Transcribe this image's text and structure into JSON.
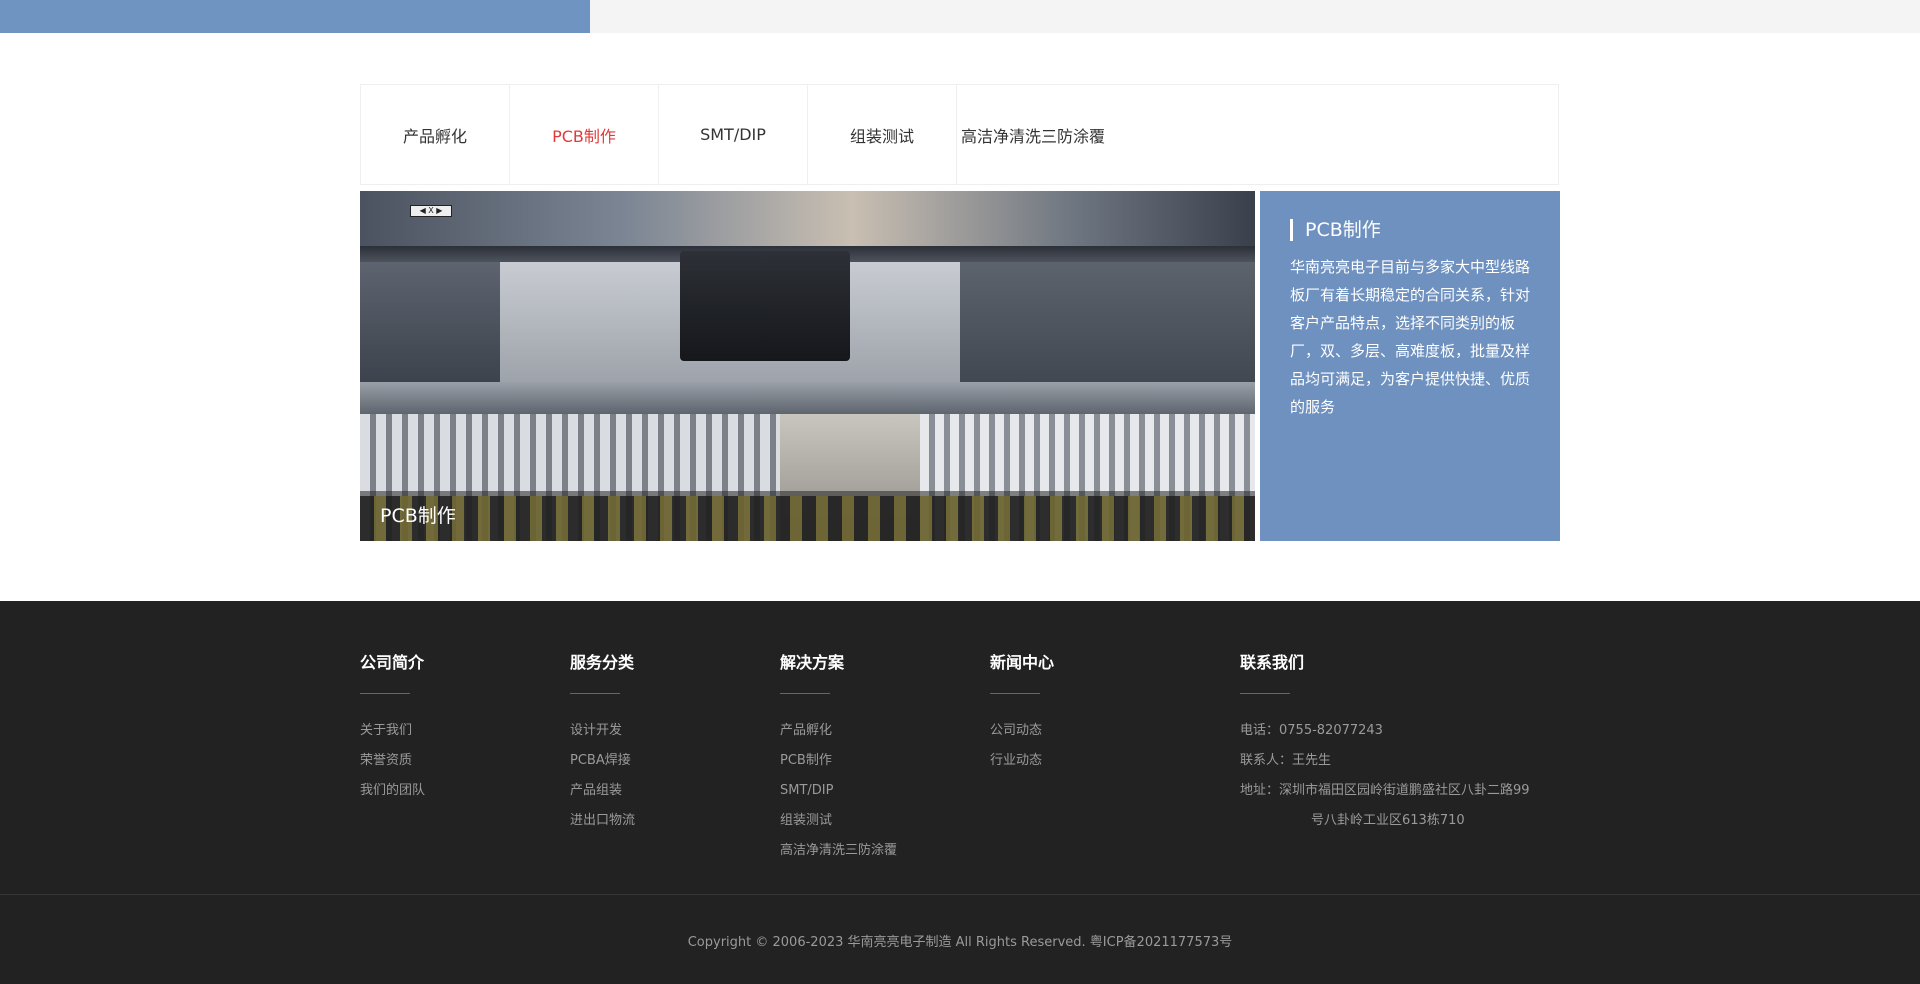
{
  "colors": {
    "accent_blue": "#7094c1",
    "active_tab": "#e23a3a",
    "footer_bg": "#222222"
  },
  "tabs": [
    {
      "label": "产品孵化",
      "active": false
    },
    {
      "label": "PCB制作",
      "active": true
    },
    {
      "label": "SMT/DIP",
      "active": false
    },
    {
      "label": "组装测试",
      "active": false
    },
    {
      "label": "高洁净清洗三防涂覆",
      "active": false
    }
  ],
  "feature": {
    "caption": "PCB制作",
    "sign_text": "◀ X ▶",
    "title": "PCB制作",
    "description": "华南亮亮电子目前与多家大中型线路板厂有着长期稳定的合同关系，针对客户产品特点，选择不同类别的板厂，双、多层、高难度板，批量及样品均可满足，为客户提供快捷、优质的服务"
  },
  "footer": {
    "columns": [
      {
        "title": "公司简介",
        "items": [
          "关于我们",
          "荣誉资质",
          "我们的团队"
        ]
      },
      {
        "title": "服务分类",
        "items": [
          "设计开发",
          "PCBA焊接",
          "产品组装",
          "进出口物流"
        ]
      },
      {
        "title": "解决方案",
        "items": [
          "产品孵化",
          "PCB制作",
          "SMT/DIP",
          "组装测试",
          "高洁净清洗三防涂覆"
        ]
      },
      {
        "title": "新闻中心",
        "items": [
          "公司动态",
          "行业动态"
        ]
      }
    ],
    "contact": {
      "title": "联系我们",
      "phone": "电话：0755-82077243",
      "person": "联系人：王先生",
      "address_line1": "地址：深圳市福田区园岭街道鹏盛社区八卦二路99",
      "address_line2": "号八卦岭工业区613栋710"
    },
    "copyright": "Copyright © 2006-2023 华南亮亮电子制造 All Rights Reserved.   粤ICP备2021177573号"
  }
}
